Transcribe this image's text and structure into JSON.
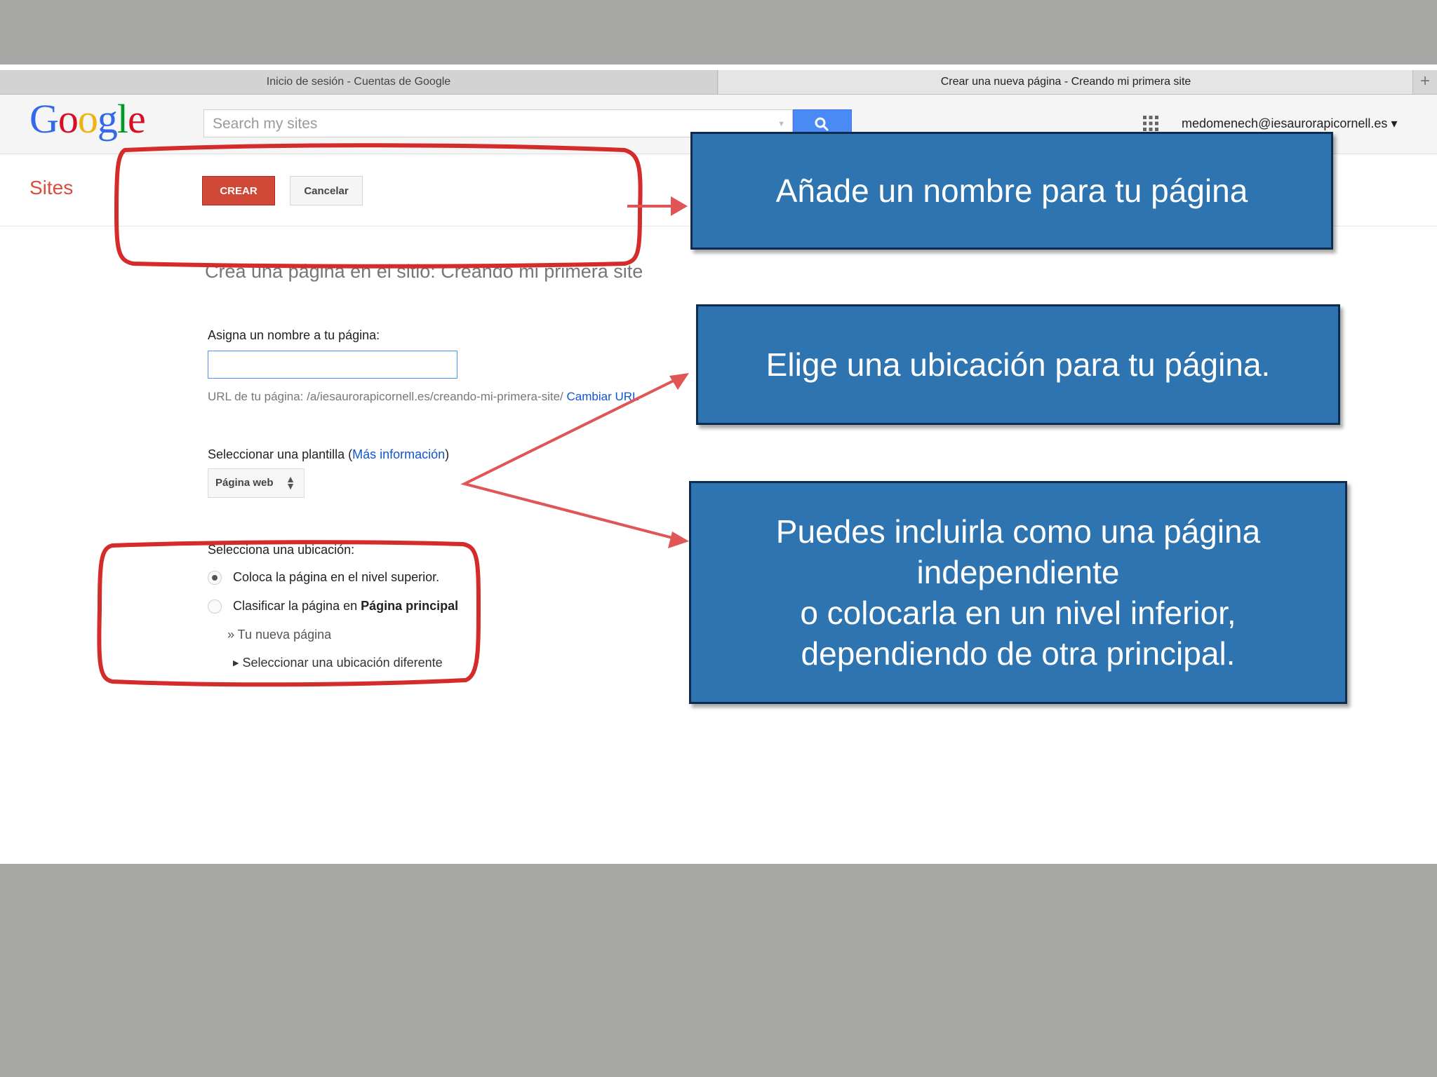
{
  "browser": {
    "tabs": [
      {
        "title": "Inicio de sesión - Cuentas de Google"
      },
      {
        "title": "Crear una nueva página - Creando mi primera site"
      }
    ],
    "new_tab_symbol": "+"
  },
  "header": {
    "logo_letters": [
      "G",
      "o",
      "o",
      "g",
      "l",
      "e"
    ],
    "logo_colors": [
      "#3369e8",
      "#d50f25",
      "#eeb211",
      "#3369e8",
      "#009925",
      "#d50f25"
    ],
    "search_placeholder": "Search my sites",
    "account_email": "medomenech@iesaurorapicornell.es",
    "account_caret": "▾"
  },
  "toolbar": {
    "app_name": "Sites",
    "create_label": "CREAR",
    "cancel_label": "Cancelar"
  },
  "form": {
    "heading": "Crea una página en el sitio: Creando mi primera site",
    "name_label": "Asigna un nombre a tu página:",
    "name_value": "",
    "url_prefix": "URL de tu página: /a/iesaurorapicornell.es/creando-mi-primera-site/",
    "url_change_link": "Cambiar URL",
    "template_label_prefix": "Seleccionar una plantilla (",
    "template_more_info": "Más información",
    "template_label_suffix": ")",
    "template_value": "Página web",
    "location_label": "Selecciona una ubicación:",
    "location_options": [
      {
        "prefix": "Coloca la página en el nivel superior.",
        "bold": "",
        "checked": true
      },
      {
        "prefix": "Clasificar la página en ",
        "bold": "Página principal",
        "checked": false
      }
    ],
    "new_page_breadcrumb": "» Tu nueva página",
    "different_location": "Seleccionar una ubicación diferente"
  },
  "callouts": [
    {
      "text": "Añade un nombre para tu página"
    },
    {
      "text": "Elige una ubicación para tu página."
    },
    {
      "text": "Puedes incluirla como una página\nindependiente\no colocarla en un nivel inferior,\ndependiendo de otra principal."
    }
  ],
  "colors": {
    "annotation_red": "#d42b2b",
    "callout_blue": "#2e74b0",
    "google_blue_button": "#4a8af4",
    "create_red": "#d14836"
  }
}
